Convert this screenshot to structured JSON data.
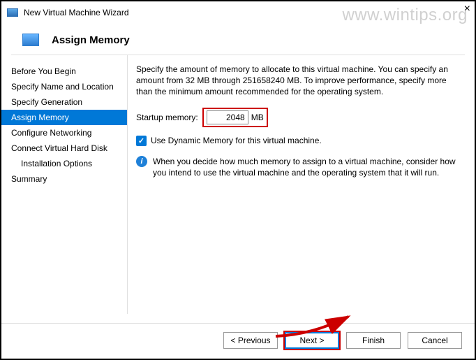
{
  "window": {
    "title": "New Virtual Machine Wizard",
    "watermark": "www.wintips.org"
  },
  "header": {
    "title": "Assign Memory"
  },
  "sidebar": {
    "items": [
      {
        "label": "Before You Begin"
      },
      {
        "label": "Specify Name and Location"
      },
      {
        "label": "Specify Generation"
      },
      {
        "label": "Assign Memory"
      },
      {
        "label": "Configure Networking"
      },
      {
        "label": "Connect Virtual Hard Disk"
      },
      {
        "label": "Installation Options"
      },
      {
        "label": "Summary"
      }
    ]
  },
  "content": {
    "description": "Specify the amount of memory to allocate to this virtual machine. You can specify an amount from 32 MB through 251658240 MB. To improve performance, specify more than the minimum amount recommended for the operating system.",
    "startup_memory_label": "Startup memory:",
    "startup_memory_value": "2048",
    "startup_memory_unit": "MB",
    "dynamic_memory_label": "Use Dynamic Memory for this virtual machine.",
    "dynamic_memory_checked": true,
    "info_text": "When you decide how much memory to assign to a virtual machine, consider how you intend to use the virtual machine and the operating system that it will run."
  },
  "footer": {
    "previous": "< Previous",
    "next": "Next >",
    "finish": "Finish",
    "cancel": "Cancel"
  },
  "annotations": {
    "memory_highlight_color": "#cc0000",
    "next_highlight_color": "#cc0000"
  }
}
